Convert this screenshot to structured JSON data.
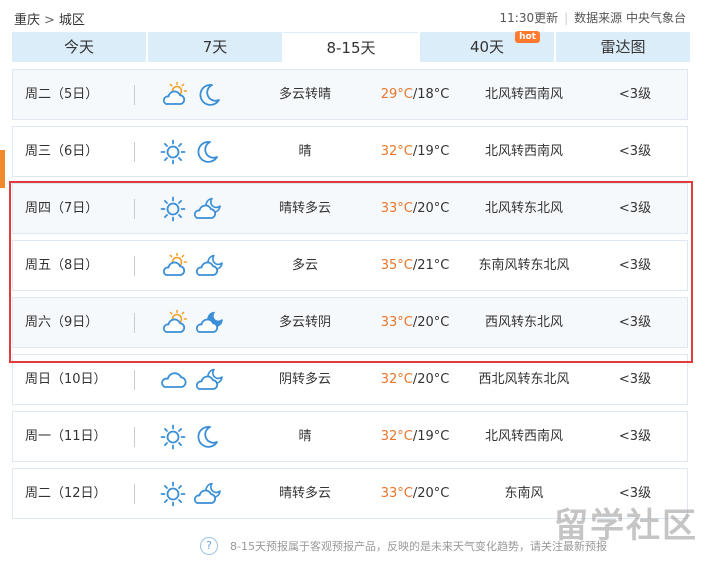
{
  "breadcrumb": {
    "city": "重庆",
    "separator": ">",
    "district": "城区"
  },
  "meta": {
    "update_time": "11:30更新",
    "source": "数据来源 中央气象台"
  },
  "tabs": [
    {
      "label": "今天",
      "active": false
    },
    {
      "label": "7天",
      "active": false
    },
    {
      "label": "8-15天",
      "active": true
    },
    {
      "label": "40天",
      "active": false,
      "badge": "hot"
    },
    {
      "label": "雷达图",
      "active": false
    }
  ],
  "forecast": [
    {
      "day": "周二（5日）",
      "icon_day": "partly-cloudy-day-icon",
      "icon_night": "moon-icon",
      "condition": "多云转晴",
      "high": "29°C",
      "low": "/18°C",
      "wind": "北风转西南风",
      "level": "<3级",
      "highlighted": true
    },
    {
      "day": "周三（6日）",
      "icon_day": "sun-icon",
      "icon_night": "moon-icon",
      "condition": "晴",
      "high": "32°C",
      "low": "/19°C",
      "wind": "北风转西南风",
      "level": "<3级",
      "highlighted": false
    },
    {
      "day": "周四（7日）",
      "icon_day": "sun-icon",
      "icon_night": "cloudy-night-icon",
      "condition": "晴转多云",
      "high": "33°C",
      "low": "/20°C",
      "wind": "北风转东北风",
      "level": "<3级",
      "highlighted": true
    },
    {
      "day": "周五（8日）",
      "icon_day": "partly-cloudy-day-icon",
      "icon_night": "cloudy-night-icon",
      "condition": "多云",
      "high": "35°C",
      "low": "/21°C",
      "wind": "东南风转东北风",
      "level": "<3级",
      "highlighted": false
    },
    {
      "day": "周六（9日）",
      "icon_day": "partly-cloudy-day-icon",
      "icon_night": "overcast-night-icon",
      "condition": "多云转阴",
      "high": "33°C",
      "low": "/20°C",
      "wind": "西风转东北风",
      "level": "<3级",
      "highlighted": true
    },
    {
      "day": "周日（10日）",
      "icon_day": "cloud-icon",
      "icon_night": "cloudy-night-icon",
      "condition": "阴转多云",
      "high": "32°C",
      "low": "/20°C",
      "wind": "西北风转东北风",
      "level": "<3级",
      "highlighted": false
    },
    {
      "day": "周一（11日）",
      "icon_day": "sun-icon",
      "icon_night": "moon-icon",
      "condition": "晴",
      "high": "32°C",
      "low": "/19°C",
      "wind": "北风转西南风",
      "level": "<3级",
      "highlighted": false
    },
    {
      "day": "周二（12日）",
      "icon_day": "sun-icon",
      "icon_night": "cloudy-night-icon",
      "condition": "晴转多云",
      "high": "33°C",
      "low": "/20°C",
      "wind": "东南风",
      "level": "<3级",
      "highlighted": false
    }
  ],
  "footnote": "8-15天预报属于客观预报产品，反映的是未来天气变化趋势，请关注最新预报",
  "watermark": "留学社区",
  "colors": {
    "tab_bg": "#dcedfa",
    "high_temp": "#e8762b",
    "highlight_border": "#e23b3b",
    "icon_blue": "#3a8fd6",
    "icon_orange": "#f0a020"
  }
}
